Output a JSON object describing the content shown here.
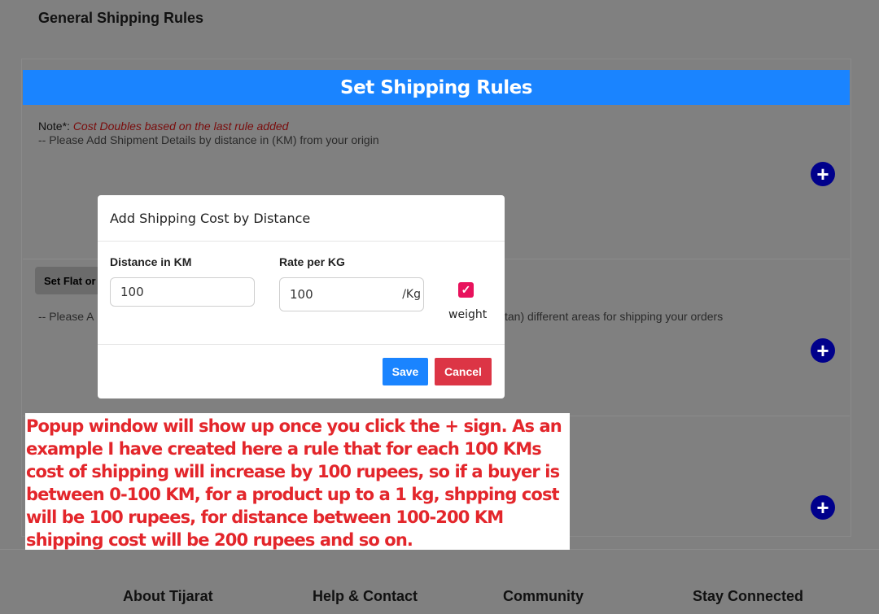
{
  "page": {
    "title": "General Shipping Rules"
  },
  "banner": {
    "title": "Set Shipping Rules"
  },
  "note": {
    "label": "Note*:",
    "emphasis": "Cost Doubles based on the last rule added",
    "sub": "-- Please Add Shipment Details by distance in (KM) from your origin"
  },
  "section2": {
    "tab_label": "Set Flat or",
    "text_left": "-- Please A",
    "text_right": "tan) different areas for shipping your orders"
  },
  "modal": {
    "title": "Add Shipping Cost by Distance",
    "distance_label": "Distance in KM",
    "distance_value": "100",
    "rate_label": "Rate per KG",
    "rate_value": "100",
    "rate_suffix": "/Kg",
    "weight_label": "weight",
    "weight_checked": true,
    "save_label": "Save",
    "cancel_label": "Cancel"
  },
  "plus_icon": "+",
  "annotation": {
    "text": "Popup window will show up once you click the + sign. As an example I have created here a rule that for each 100 KMs cost of shipping will increase by 100 rupees, so if a buyer is between 0-100 KM, for a product up to a 1 kg, shpping cost will be 100 rupees, for distance between 100-200 KM shipping cost will be 200 rupees and so on."
  },
  "footer": {
    "about": "About Tijarat",
    "help": "Help & Contact",
    "community": "Community",
    "stay": "Stay Connected"
  },
  "colors": {
    "banner": "#1a84ff",
    "plus": "#00008b",
    "save": "#1a84ff",
    "cancel": "#dc3545",
    "checkbox": "#e8125c",
    "annotation_text": "#e3262b"
  }
}
